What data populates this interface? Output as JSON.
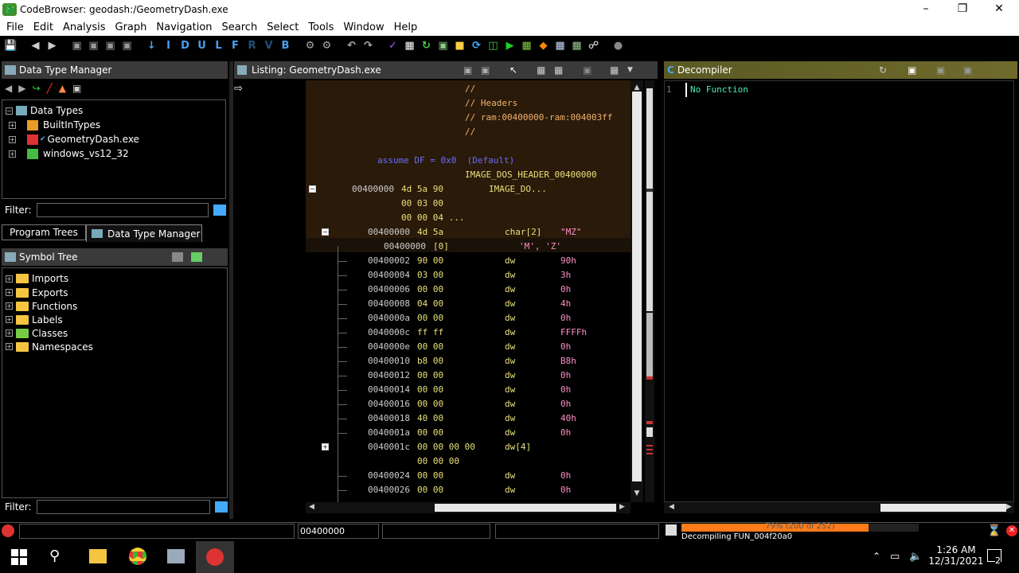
{
  "window": {
    "title": "CodeBrowser: geodash:/GeometryDash.exe"
  },
  "menu": [
    "File",
    "Edit",
    "Analysis",
    "Graph",
    "Navigation",
    "Search",
    "Select",
    "Tools",
    "Window",
    "Help"
  ],
  "toolbar_letters": [
    "I",
    "D",
    "U",
    "L",
    "F",
    "R",
    "V",
    "B"
  ],
  "data_type_manager": {
    "title": "Data Type Manager",
    "root": "Data Types",
    "items": [
      "BuiltInTypes",
      "GeometryDash.exe",
      "windows_vs12_32"
    ],
    "filter_label": "Filter:"
  },
  "tabs": {
    "program_trees": "Program Trees",
    "data_type_manager": "Data Type Manager"
  },
  "symbol_tree": {
    "title": "Symbol Tree",
    "items": [
      "Imports",
      "Exports",
      "Functions",
      "Labels",
      "Classes",
      "Namespaces"
    ],
    "filter_label": "Filter:"
  },
  "listing": {
    "title": "Listing:  GeometryDash.exe",
    "comments": [
      "//",
      "// Headers",
      "// ram:00400000-ram:004003ff",
      "//"
    ],
    "assume": "assume DF = 0x0  (Default)",
    "header_label": "IMAGE_DOS_HEADER_00400000",
    "struct_line": {
      "addr": "00400000",
      "bytes": "4d 5a 90",
      "text": "IMAGE_DO..."
    },
    "cont_bytes": [
      "00 03 00",
      "00 00 04 ..."
    ],
    "char_line": {
      "addr": "00400000",
      "bytes": "4d 5a",
      "mn": "char[2]",
      "op": "\"MZ\""
    },
    "char_sub": {
      "addr": "00400000",
      "bytes": "[0]",
      "op": "'M', 'Z'"
    },
    "rows": [
      {
        "addr": "00400002",
        "bytes": "90 00",
        "mn": "dw",
        "op": "90h"
      },
      {
        "addr": "00400004",
        "bytes": "03 00",
        "mn": "dw",
        "op": "3h"
      },
      {
        "addr": "00400006",
        "bytes": "00 00",
        "mn": "dw",
        "op": "0h"
      },
      {
        "addr": "00400008",
        "bytes": "04 00",
        "mn": "dw",
        "op": "4h"
      },
      {
        "addr": "0040000a",
        "bytes": "00 00",
        "mn": "dw",
        "op": "0h"
      },
      {
        "addr": "0040000c",
        "bytes": "ff ff",
        "mn": "dw",
        "op": "FFFFh"
      },
      {
        "addr": "0040000e",
        "bytes": "00 00",
        "mn": "dw",
        "op": "0h"
      },
      {
        "addr": "00400010",
        "bytes": "b8 00",
        "mn": "dw",
        "op": "B8h"
      },
      {
        "addr": "00400012",
        "bytes": "00 00",
        "mn": "dw",
        "op": "0h"
      },
      {
        "addr": "00400014",
        "bytes": "00 00",
        "mn": "dw",
        "op": "0h"
      },
      {
        "addr": "00400016",
        "bytes": "00 00",
        "mn": "dw",
        "op": "0h"
      },
      {
        "addr": "00400018",
        "bytes": "40 00",
        "mn": "dw",
        "op": "40h"
      },
      {
        "addr": "0040001a",
        "bytes": "00 00",
        "mn": "dw",
        "op": "0h"
      }
    ],
    "array_line": {
      "addr": "0040001c",
      "bytes": "00 00 00 00",
      "mn": "dw[4]"
    },
    "array_cont": "00 00 00",
    "rows2": [
      {
        "addr": "00400024",
        "bytes": "00 00",
        "mn": "dw",
        "op": "0h"
      },
      {
        "addr": "00400026",
        "bytes": "00 00",
        "mn": "dw",
        "op": "0h"
      }
    ]
  },
  "decompiler": {
    "title": "Decompiler",
    "line_no": "1",
    "text": "No Function"
  },
  "status": {
    "address": "00400000",
    "progress_label": "79% (200 of 252)",
    "progress": 0.79,
    "task": "Decompiling FUN_004f20a0"
  },
  "taskbar": {
    "time": "1:26 AM",
    "date": "12/31/2021",
    "notifications": "2"
  },
  "colors": {
    "listing_bg": "#2a1a0a",
    "progress": "#ff7a1a",
    "hdr_decompiler": "#6f6a2c"
  }
}
